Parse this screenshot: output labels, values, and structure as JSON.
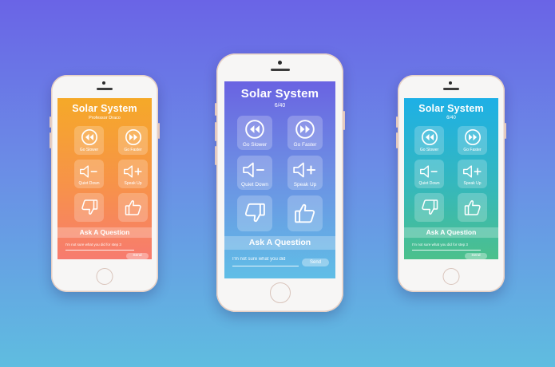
{
  "phones": {
    "left": {
      "title": "Solar System",
      "subtitle": "Professor Draco",
      "buttons": {
        "slower": "Go Slower",
        "faster": "Go Faster",
        "quiet": "Quiet Down",
        "speak": "Speak Up"
      },
      "ask_label": "Ask A Question",
      "question_value": "I'm not sure what you did for step 3",
      "send_label": "Send",
      "gradient_top": "#f4a62a",
      "gradient_bottom": "#f77b6b"
    },
    "center": {
      "title": "Solar System",
      "subtitle": "6/40",
      "buttons": {
        "slower": "Go Slower",
        "faster": "Go Faster",
        "quiet": "Quiet Down",
        "speak": "Speak Up"
      },
      "ask_label": "Ask A Question",
      "question_value": "I'm not sure what you did",
      "send_label": "Send",
      "gradient_top": "#6a64e3",
      "gradient_bottom": "#5fc1e6"
    },
    "right": {
      "title": "Solar System",
      "subtitle": "6/40",
      "buttons": {
        "slower": "Go Slower",
        "faster": "Go Faster",
        "quiet": "Quiet Down",
        "speak": "Speak Up"
      },
      "ask_label": "Ask A Question",
      "question_value": "I'm not sure what you did for step 3",
      "send_label": "Send",
      "gradient_top": "#1fb3e6",
      "gradient_bottom": "#4cc08a"
    }
  }
}
